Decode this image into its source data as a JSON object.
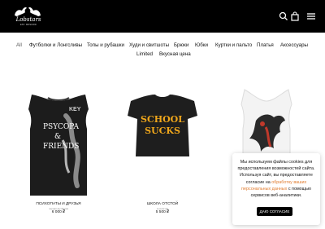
{
  "header": {
    "logo_text": "Lobstars",
    "logo_sub": "EST. MOSCOW",
    "icons": [
      "search-icon",
      "shopping-bag-icon",
      "menu-icon"
    ]
  },
  "nav": {
    "items": [
      "All",
      "Футболки и Лонгсливы",
      "Топы и рубашки",
      "Худи и свитшоты",
      "Брюки",
      "Юбки",
      "Куртки и пальто",
      "Платья",
      "Аксессуары",
      "Limited",
      "Вкусная цена"
    ],
    "active": "All"
  },
  "products": [
    {
      "name": "ПСИХОПАТЫ И ДРУЗЬЯ",
      "subtitle": "черная футболка",
      "price": "6 000 ₽",
      "print_lines": [
        "PSYCOPA",
        "&",
        "FRIENDS"
      ]
    },
    {
      "name": "ШКОЛА ОТСТОЙ",
      "subtitle": "в наличии",
      "price": "5 500 ₽",
      "print_lines": [
        "SCHOOL",
        "SUCKS"
      ]
    },
    {
      "name": "",
      "subtitle": "",
      "price": "",
      "print_lines": []
    }
  ],
  "cookie": {
    "text_1": "Мы используем файлы cookies для предоставления возможностей сайта. Используя сайт, вы предоставляете согласие на ",
    "link": "обработку ваших персональных данных",
    "text_2": " с помощью сервисов веб-аналитики.",
    "button": "ДАЮ СОГЛАСИЕ"
  },
  "colors": {
    "header_bg": "#000000",
    "accent_link": "#e07b2e",
    "print_yellow": "#f0a71b"
  }
}
